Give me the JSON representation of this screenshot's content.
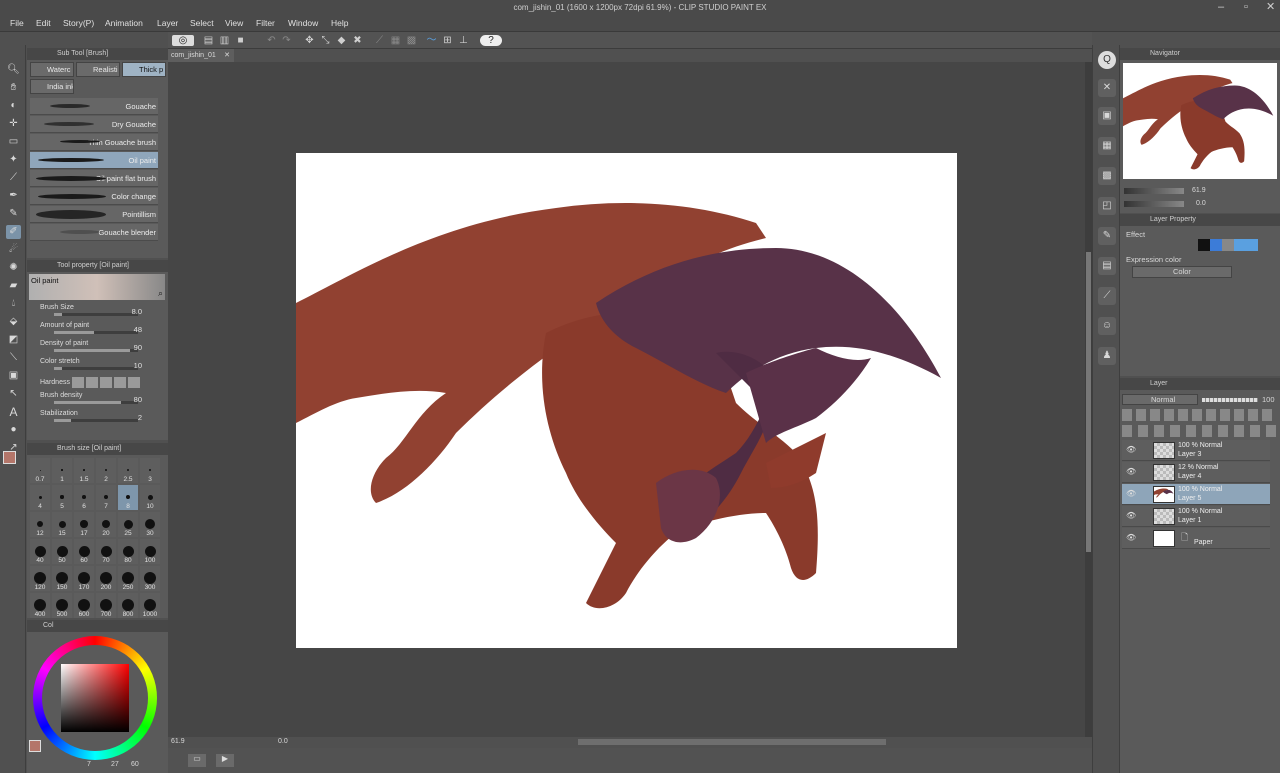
{
  "window": {
    "title": "com_jishin_01 (1600 x 1200px 72dpi 61.9%) - CLIP STUDIO PAINT EX"
  },
  "menu": [
    "File",
    "Edit",
    "Story(P)",
    "Animation",
    "Layer",
    "Select",
    "View",
    "Filter",
    "Window",
    "Help"
  ],
  "document_tab": {
    "label": "com_jishin_01"
  },
  "subtool_panel": {
    "title": "Sub Tool [Brush]",
    "tabs": [
      "Waterc",
      "Realisti",
      "Thick p",
      "India ink"
    ],
    "selected_tab": "Thick p",
    "brushes": [
      "Gouache",
      "Dry Gouache",
      "Thin Gouache brush",
      "Oil paint",
      "Oil paint flat brush",
      "Color change",
      "Pointillism",
      "Gouache blender"
    ],
    "selected_brush": "Oil paint"
  },
  "tool_property": {
    "title": "Tool property [Oil paint]",
    "preset_name": "Oil paint",
    "properties": [
      {
        "label": "Brush Size",
        "value": "8.0",
        "fill": 0.1
      },
      {
        "label": "Amount of paint",
        "value": "48",
        "fill": 0.48
      },
      {
        "label": "Density of paint",
        "value": "90",
        "fill": 0.9
      },
      {
        "label": "Color stretch",
        "value": "10",
        "fill": 0.1
      },
      {
        "label": "Hardness",
        "value": ""
      },
      {
        "label": "Brush density",
        "value": "80",
        "fill": 0.8
      },
      {
        "label": "Stabilization",
        "value": "2",
        "fill": 0.2
      }
    ]
  },
  "brush_size_panel": {
    "title": "Brush size [Oil paint]",
    "sizes": [
      "0.7",
      "1",
      "1.5",
      "2",
      "2.5",
      "3",
      "4",
      "5",
      "6",
      "7",
      "8",
      "10",
      "12",
      "15",
      "17",
      "20",
      "25",
      "30",
      "40",
      "50",
      "60",
      "70",
      "80",
      "100",
      "120",
      "150",
      "170",
      "200",
      "250",
      "300",
      "400",
      "500",
      "600",
      "700",
      "800",
      "1000"
    ],
    "selected": "8"
  },
  "color_panel": {
    "tab": "Col",
    "values": [
      "7",
      "27",
      "60"
    ],
    "main_color": "#b4766a"
  },
  "navigator": {
    "title": "Navigator",
    "zoom": "61.9",
    "rotation": "0.0"
  },
  "layer_property": {
    "title": "Layer Property",
    "effect_label": "Effect",
    "expression_label": "Expression color",
    "expression_value": "Color"
  },
  "layer_panel": {
    "title": "Layer",
    "blend_mode": "Normal",
    "opacity": "100",
    "layers": [
      {
        "mode": "100 % Normal",
        "name": "Layer 3",
        "selected": false
      },
      {
        "mode": "12 % Normal",
        "name": "Layer 4",
        "selected": false
      },
      {
        "mode": "100 % Normal",
        "name": "Layer 5",
        "selected": true
      },
      {
        "mode": "100 % Normal",
        "name": "Layer 1",
        "selected": false
      },
      {
        "mode": "",
        "name": "Paper",
        "selected": false
      }
    ]
  },
  "statusbar": {
    "zoom": "61.9",
    "angle": "0.0"
  },
  "colors": {
    "dragon_body": "#8e3b2c",
    "wing_membrane": "#914131",
    "wing_purple": "#583248",
    "horn": "#4a2a40"
  }
}
